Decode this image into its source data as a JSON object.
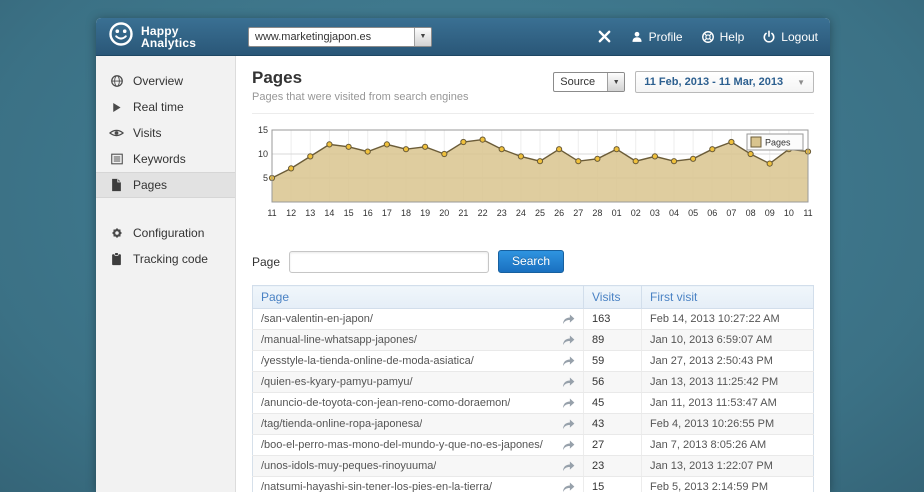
{
  "app": {
    "name_line1": "Happy",
    "name_line2": "Analytics"
  },
  "header": {
    "site_selector_value": "www.marketingjapon.es",
    "profile_label": "Profile",
    "help_label": "Help",
    "logout_label": "Logout"
  },
  "sidebar": {
    "groups": [
      {
        "items": [
          {
            "label": "Overview",
            "icon": "globe-icon",
            "active": false
          },
          {
            "label": "Real time",
            "icon": "play-icon",
            "active": false
          },
          {
            "label": "Visits",
            "icon": "eye-icon",
            "active": false
          },
          {
            "label": "Keywords",
            "icon": "list-icon",
            "active": false
          },
          {
            "label": "Pages",
            "icon": "page-icon",
            "active": true
          }
        ]
      },
      {
        "items": [
          {
            "label": "Configuration",
            "icon": "gear-icon",
            "active": false
          },
          {
            "label": "Tracking code",
            "icon": "clipboard-icon",
            "active": false
          }
        ]
      }
    ]
  },
  "page": {
    "title": "Pages",
    "subtitle": "Pages that were visited from search engines",
    "source_label": "Source",
    "date_range": "11 Feb, 2013 - 11 Mar, 2013"
  },
  "chart_data": {
    "type": "area",
    "legend": "Pages",
    "legend_position": "top-right",
    "x": [
      "11",
      "12",
      "13",
      "14",
      "15",
      "16",
      "17",
      "18",
      "19",
      "20",
      "21",
      "22",
      "23",
      "24",
      "25",
      "26",
      "27",
      "28",
      "01",
      "02",
      "03",
      "04",
      "05",
      "06",
      "07",
      "08",
      "09",
      "10",
      "11"
    ],
    "values": [
      5,
      7,
      9.5,
      12,
      11.5,
      10.5,
      12,
      11,
      11.5,
      10,
      12.5,
      13,
      11,
      9.5,
      8.5,
      11,
      8.5,
      9,
      11,
      8.5,
      9.5,
      8.5,
      9,
      11,
      12.5,
      10,
      8,
      11,
      10.5
    ],
    "ylim": [
      0,
      15
    ],
    "yticks": [
      5,
      10,
      15
    ],
    "grid": true,
    "fill_color": "#d9c48e",
    "line_color": "#6b5c38",
    "marker_color": "#f0c13c"
  },
  "search": {
    "label": "Page",
    "button_label": "Search",
    "value": ""
  },
  "table": {
    "headers": [
      "Page",
      "Visits",
      "First visit"
    ],
    "rows": [
      {
        "page": "/san-valentin-en-japon/",
        "visits": "163",
        "first_visit": "Feb 14, 2013 10:27:22 AM"
      },
      {
        "page": "/manual-line-whatsapp-japones/",
        "visits": "89",
        "first_visit": "Jan 10, 2013 6:59:07 AM"
      },
      {
        "page": "/yesstyle-la-tienda-online-de-moda-asiatica/",
        "visits": "59",
        "first_visit": "Jan 27, 2013 2:50:43 PM"
      },
      {
        "page": "/quien-es-kyary-pamyu-pamyu/",
        "visits": "56",
        "first_visit": "Jan 13, 2013 11:25:42 PM"
      },
      {
        "page": "/anuncio-de-toyota-con-jean-reno-como-doraemon/",
        "visits": "45",
        "first_visit": "Jan 11, 2013 11:53:47 AM"
      },
      {
        "page": "/tag/tienda-online-ropa-japonesa/",
        "visits": "43",
        "first_visit": "Feb 4, 2013 10:26:55 PM"
      },
      {
        "page": "/boo-el-perro-mas-mono-del-mundo-y-que-no-es-japones/",
        "visits": "27",
        "first_visit": "Jan 7, 2013 8:05:26 AM"
      },
      {
        "page": "/unos-idols-muy-peques-rinoyuuma/",
        "visits": "23",
        "first_visit": "Jan 13, 2013 1:22:07 PM"
      },
      {
        "page": "/natsumi-hayashi-sin-tener-los-pies-en-la-tierra/",
        "visits": "15",
        "first_visit": "Feb 5, 2013 2:14:59 PM"
      }
    ]
  }
}
